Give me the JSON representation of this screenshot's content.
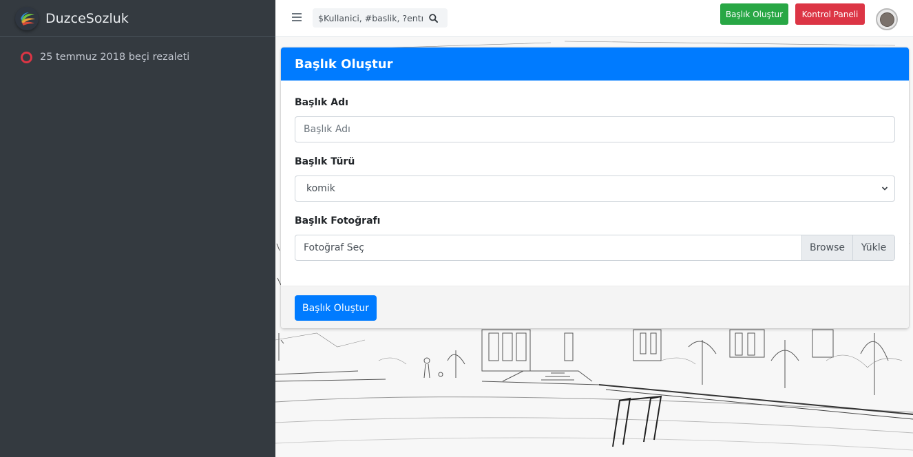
{
  "brand": {
    "name": "DuzceSozluk"
  },
  "sidebar": {
    "items": [
      {
        "label": "25 temmuz 2018 beçi rezaleti",
        "icon": "circle-icon"
      }
    ]
  },
  "navbar": {
    "search_placeholder": "$Kullanici, #baslik, ?entry",
    "create_label": "Başlık Oluştur",
    "panel_label": "Kontrol Paneli"
  },
  "card": {
    "title": "Başlık Oluştur",
    "name_label": "Başlık Adı",
    "name_placeholder": "Başlık Adı",
    "type_label": "Başlık Türü",
    "type_value": "komik",
    "photo_label": "Başlık Fotoğrafı",
    "photo_placeholder": "Fotoğraf Seç",
    "browse_label": "Browse",
    "upload_label": "Yükle",
    "submit_label": "Başlık Oluştur"
  },
  "colors": {
    "sidebar_bg": "#343a40",
    "primary": "#007bff",
    "success": "#28a745",
    "danger": "#dc3545"
  }
}
